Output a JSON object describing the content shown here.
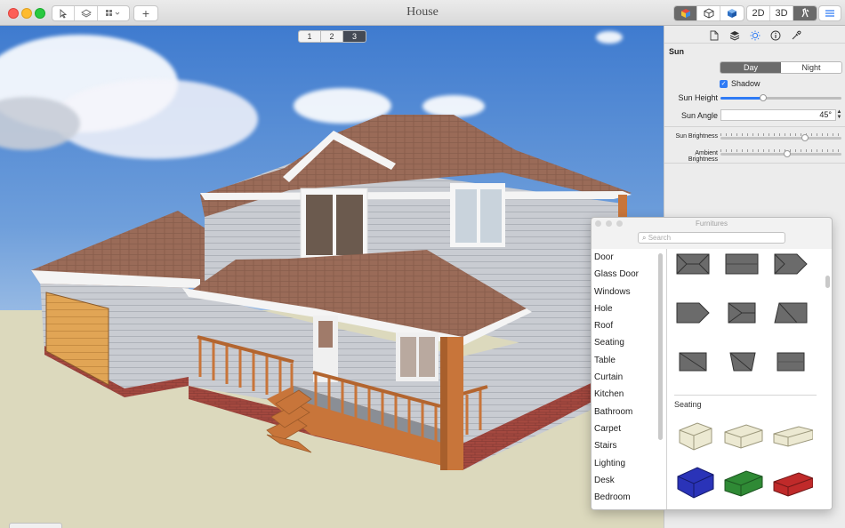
{
  "window": {
    "title": "House"
  },
  "toolbar": {
    "left_icons": [
      "cursor-icon",
      "hand-pan-icon",
      "grid-select-icon"
    ],
    "add_label": "+",
    "view_modes": [
      "2D",
      "3D"
    ],
    "view_mode_active": "walk",
    "object_icons": [
      "colored-cube-icon",
      "wireframe-cube-icon",
      "blue-cube-icon"
    ]
  },
  "viewport": {
    "pages": [
      "1",
      "2",
      "3"
    ],
    "active_page": "3"
  },
  "inspector": {
    "tabs": [
      "document-icon",
      "layers-icon",
      "sun-icon",
      "info-icon",
      "eyedropper-icon"
    ],
    "active_tab": "sun-icon",
    "section_title": "Sun",
    "day_label": "Day",
    "night_label": "Night",
    "active_mode": "Day",
    "shadow_label": "Shadow",
    "shadow_checked": true,
    "sun_height_label": "Sun Height",
    "sun_height_value": 0.35,
    "sun_angle_label": "Sun Angle",
    "sun_angle_value": "45°",
    "sun_brightness_label": "Sun Brightness",
    "sun_brightness_value": 0.7,
    "ambient_brightness_label": "Ambient Brightness",
    "ambient_brightness_value": 0.55
  },
  "furnitures": {
    "title": "Furnitures",
    "search_placeholder": "Search",
    "categories": [
      "Door",
      "Glass Door",
      "Windows",
      "Hole",
      "Roof",
      "Seating",
      "Table",
      "Curtain",
      "Kitchen",
      "Bathroom",
      "Carpet",
      "Stairs",
      "Lighting",
      "Desk",
      "Bedroom"
    ],
    "seating_section": "Seating"
  },
  "colors": {
    "accent": "#2f7bf5",
    "roof": "#9a6b58",
    "siding": "#c7cbd0",
    "brick": "#a4483f",
    "wood": "#c8753a"
  }
}
